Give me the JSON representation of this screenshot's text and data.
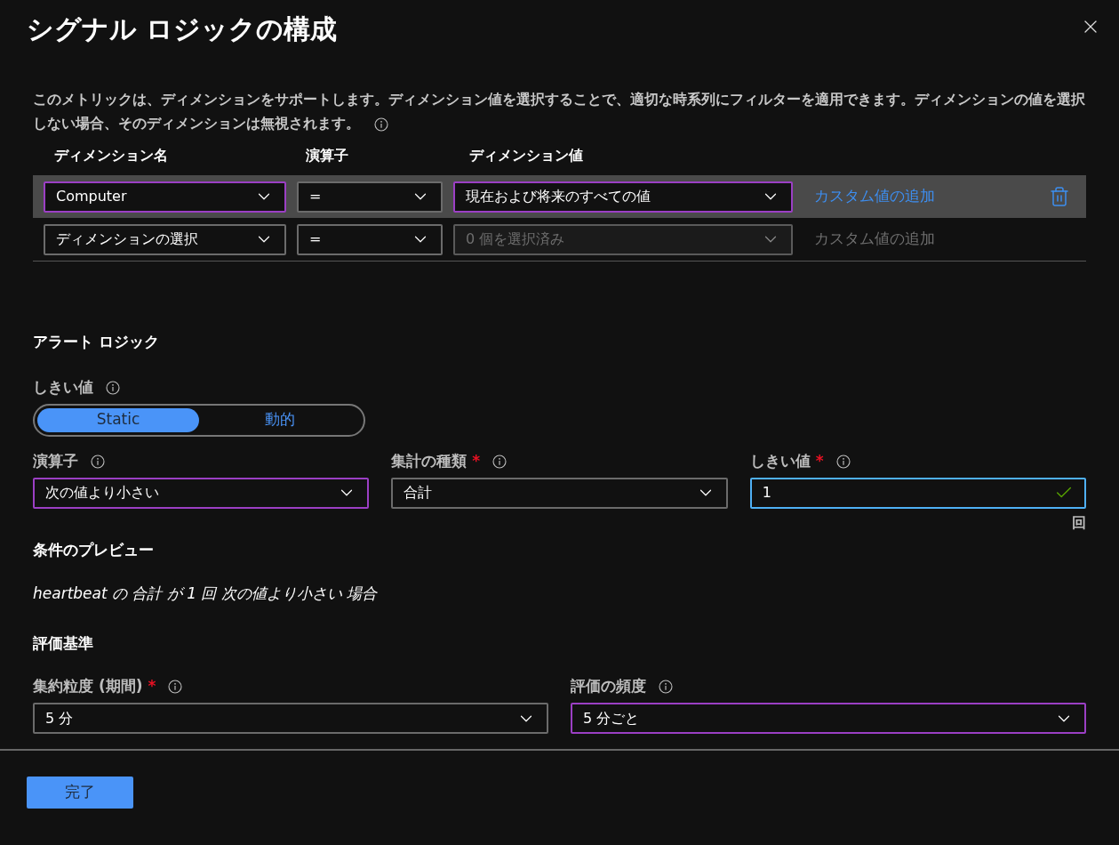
{
  "title": "シグナル ロジックの構成",
  "description": "このメトリックは、ディメンションをサポートします。ディメンション値を選択することで、適切な時系列にフィルターを適用できます。ディメンションの値を選択しない場合、そのディメンションは無視されます。",
  "dimensions": {
    "columns": [
      "ディメンション名",
      "演算子",
      "ディメンション値"
    ],
    "rows": [
      {
        "selected": true,
        "name": {
          "value": "Computer",
          "highlighted": true
        },
        "operator": {
          "value": "=",
          "highlighted": false
        },
        "values": {
          "value": "現在および将来のすべての値",
          "highlighted": true,
          "disabled": false
        },
        "custom_link": {
          "label": "カスタム値の追加",
          "disabled": false
        },
        "deletable": true
      },
      {
        "selected": false,
        "name": {
          "value": "ディメンションの選択",
          "highlighted": false
        },
        "operator": {
          "value": "=",
          "highlighted": false
        },
        "values": {
          "value": "0 個を選択済み",
          "highlighted": false,
          "disabled": true
        },
        "custom_link": {
          "label": "カスタム値の追加",
          "disabled": true
        },
        "deletable": false
      }
    ]
  },
  "alert_logic": {
    "heading": "アラート ロジック",
    "threshold_type": {
      "label": "しきい値",
      "options": [
        {
          "label": "Static",
          "selected": true
        },
        {
          "label": "動的",
          "selected": false
        }
      ]
    },
    "fields": [
      {
        "kind": "select",
        "label": "演算子",
        "value": "次の値より小さい",
        "highlighted": true
      },
      {
        "kind": "select",
        "label": "集計の種類",
        "required_mark": "*",
        "value": "合計",
        "highlighted": false
      },
      {
        "kind": "input",
        "label": "しきい値",
        "required_mark": "*",
        "value": "1",
        "valid": true,
        "unit": "回"
      }
    ]
  },
  "preview": {
    "heading": "条件のプレビュー",
    "text": "heartbeat の 合計 が 1 回 次の値より小さい 場合"
  },
  "evaluation": {
    "heading": "評価基準",
    "fields": [
      {
        "label": "集約粒度 (期間)",
        "required_mark": "*",
        "value": "5 分",
        "highlighted": false
      },
      {
        "label": "評価の頻度",
        "value": "5 分ごと",
        "highlighted": true
      }
    ]
  },
  "footer": {
    "done_button": "完了"
  }
}
